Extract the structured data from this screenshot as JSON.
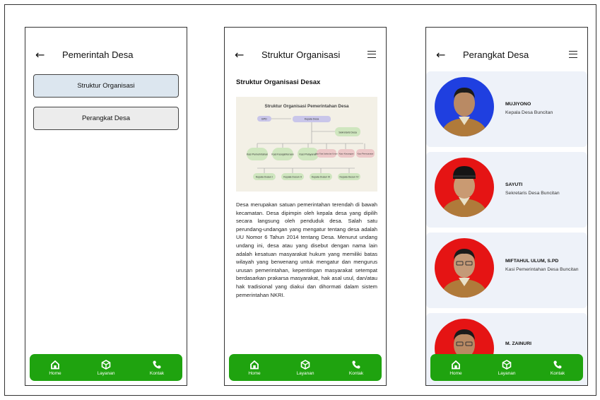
{
  "screen1": {
    "title": "Pemerintah Desa",
    "buttons": [
      "Struktur Organisasi",
      "Perangkat Desa"
    ]
  },
  "screen2": {
    "title": "Struktur Organisasi",
    "section_title": "Struktur Organisasi Desax",
    "diagram": {
      "title": "Struktur Organisasi Pemerintahan Desa",
      "nodes": [
        "BPD",
        "Kepala Desa",
        "Sekretaris Desa",
        "Kasi Pemerintahan",
        "Kasi Kesejahteraan",
        "Kasi Pelayanan",
        "Kaur Tata Usaha dan Umum",
        "Kaur Keuangan",
        "Kaur Perencanaan",
        "Kepala Dusun I",
        "Kepala Dusun II",
        "Kepala Dusun III",
        "Kepala Dusun IV"
      ]
    },
    "paragraph": "Desa merupakan satuan pemerintahan terendah di bawah kecamatan. Desa dipimpin oleh kepala desa yang dipilih secara langsung oleh penduduk desa. Salah satu perundang-undangan yang mengatur tentang desa adalah UU Nomor 6 Tahun 2014 tentang Desa. Menurut undang undang ini, desa atau yang disebut dengan nama lain adalah kesatuan masyarakat hukum yang memiliki batas wilayah yang berwenang untuk mengatur dan mengurus urusan pemerintahan, kepentingan masyarakat setempat berdasarkan prakarsa masyarakat, hak asal usul, dan/atau hak tradisional yang diakui dan dihormati dalam sistem pemerintahan NKRI."
  },
  "screen3": {
    "title": "Perangkat Desa",
    "people": [
      {
        "name": "MUJIYONO",
        "role": "Kepala Desa Buncitan",
        "bg": "#1f3fe0"
      },
      {
        "name": "SAYUTI",
        "role": "Sekretaris Desa Buncitan",
        "bg": "#e51414"
      },
      {
        "name": "MIFTAHUL ULUM, S.PD",
        "role": "Kasi Pemerintahan Desa Buncitan",
        "bg": "#e51414"
      },
      {
        "name": "M. ZAINURI",
        "role": "",
        "bg": "#e51414"
      }
    ]
  },
  "nav": {
    "home": "Home",
    "layanan": "Layanan",
    "kontak": "Kontak"
  },
  "colors": {
    "nav_green": "#1fa30f",
    "button_blue": "#dce6ef",
    "card_bg": "#eef2f9"
  }
}
